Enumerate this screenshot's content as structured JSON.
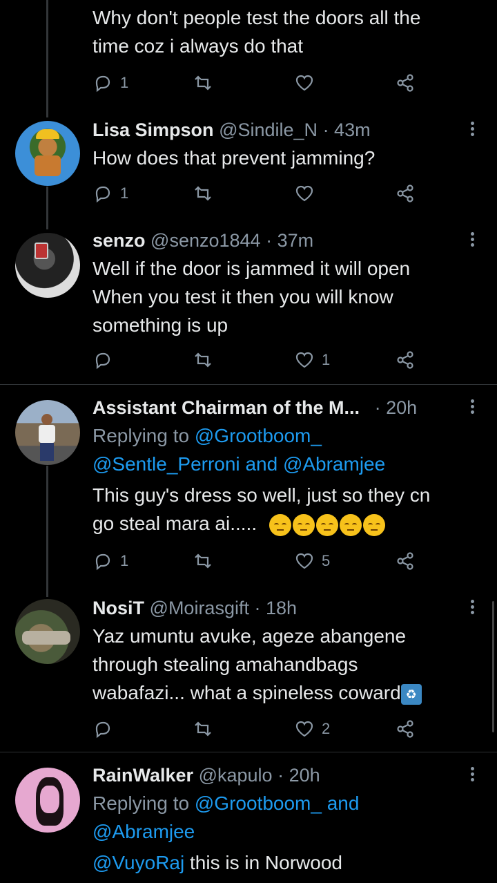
{
  "tweets": [
    {
      "text_lines": [
        "Why don't people test the doors all the",
        "time coz i always do that"
      ],
      "reply_count": "1",
      "retweet_count": "",
      "like_count": ""
    },
    {
      "name": "Lisa Simpson",
      "handle": "@Sindile_N",
      "time": "· 43m",
      "text_lines": [
        "How does that prevent jamming?"
      ],
      "reply_count": "1",
      "retweet_count": "",
      "like_count": ""
    },
    {
      "name": "senzo",
      "handle": "@senzo1844",
      "time": "· 37m",
      "text_lines": [
        "Well if the door is jammed it will open",
        "When you test it then you will know",
        "something is up"
      ],
      "reply_count": "",
      "retweet_count": "",
      "like_count": "1"
    },
    {
      "name": "Assistant Chairman of the M...",
      "handle": "",
      "time": "· 20h",
      "replying_label": "Replying to",
      "replying_line1": "@Grootboom_",
      "replying_line2_a": "@Sentle_Perroni",
      "replying_and": "and",
      "replying_line2_b": "@Abramjee",
      "text_lines": [
        "This guy's dress so well, just so they cn",
        "go steal mara ai....."
      ],
      "emoji": "😔😔😔😔😔",
      "reply_count": "1",
      "retweet_count": "",
      "like_count": "5"
    },
    {
      "name": "NosiT",
      "handle": "@Moirasgift",
      "time": "· 18h",
      "text_lines": [
        "Yaz umuntu avuke, ageze abangene",
        "through stealing amahandbags",
        "wabafazi... what a spineless coward"
      ],
      "trailing_emoji": "🚮",
      "reply_count": "",
      "retweet_count": "",
      "like_count": "2"
    },
    {
      "name": "RainWalker",
      "handle": "@kapulo",
      "time": "· 20h",
      "replying_label": "Replying to",
      "replying_line1": "@Grootboom_ and",
      "replying_line2": "@Abramjee",
      "mention": "@VuyoRaj",
      "text_after_mention": " this is in Norwood"
    }
  ],
  "icons": {
    "reply": "reply-icon",
    "retweet": "retweet-icon",
    "like": "heart-icon",
    "share": "share-icon",
    "more": "more-icon"
  },
  "colors": {
    "background": "#000000",
    "text": "#e7e9ea",
    "muted": "#8b98a5",
    "link": "#1d9bf0",
    "divider": "#2f3336"
  }
}
